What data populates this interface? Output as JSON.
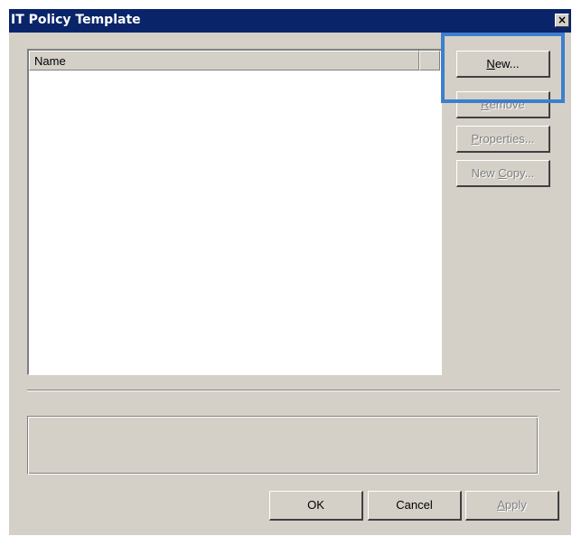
{
  "window": {
    "title": "IT Policy Template",
    "close_glyph": "×"
  },
  "list": {
    "columns": [
      "Name",
      ""
    ],
    "items": []
  },
  "side_buttons": {
    "new": {
      "pre": "",
      "accel": "N",
      "post": "ew..."
    },
    "remove": {
      "pre": "",
      "accel": "R",
      "post": "emove"
    },
    "properties": {
      "pre": "",
      "accel": "P",
      "post": "roperties..."
    },
    "new_copy": {
      "pre": "New ",
      "accel": "C",
      "post": "opy..."
    }
  },
  "footer": {
    "description": "",
    "ok": "OK",
    "cancel": "Cancel",
    "apply": {
      "pre": "",
      "accel": "A",
      "post": "pply"
    }
  },
  "colors": {
    "titlebar": "#0a246a",
    "face": "#d4d0c8",
    "highlight": "#3d7fcc"
  }
}
